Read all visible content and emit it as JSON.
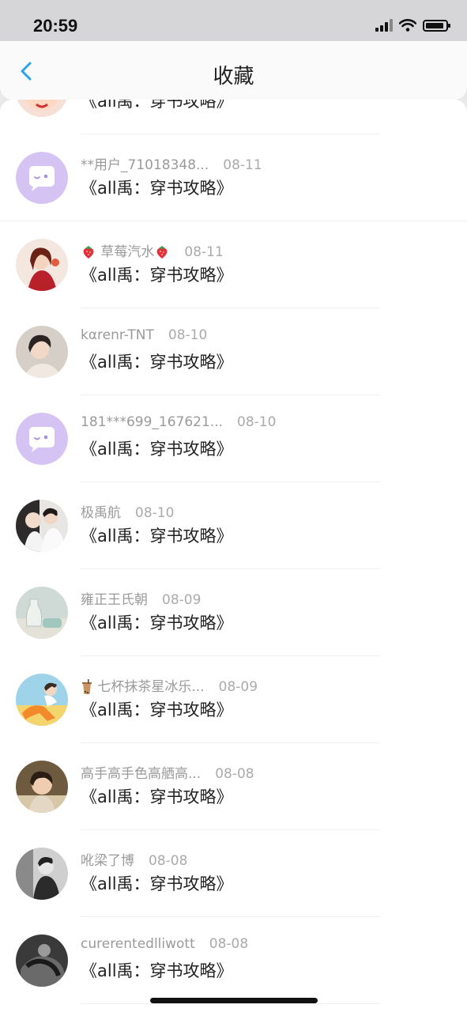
{
  "status": {
    "time": "20:59"
  },
  "nav": {
    "title": "收藏"
  },
  "book_title": "《all禹：穿书攻略》",
  "items": [
    {
      "user": "",
      "date": "",
      "book": "《all禹：穿书攻略》",
      "avatar": "tnt-cartoon"
    },
    {
      "user": "**用户_71018348...",
      "date": "08-11",
      "book": "《all禹：穿书攻略》",
      "avatar": "default-chat"
    },
    {
      "user": "草莓汽水",
      "date": "08-11",
      "book": "《all禹：穿书攻略》",
      "avatar": "girl-red-dress",
      "emoji": "strawberry"
    },
    {
      "user": "kαrenr-TNT",
      "date": "08-10",
      "book": "《all禹：穿书攻略》",
      "avatar": "boy-portrait"
    },
    {
      "user": "181***699_167621...",
      "date": "08-10",
      "book": "《all禹：穿书攻略》",
      "avatar": "default-chat"
    },
    {
      "user": "极禹航",
      "date": "08-10",
      "book": "《all禹：穿书攻略》",
      "avatar": "couple-photo"
    },
    {
      "user": "雍正王氏朝",
      "date": "08-09",
      "book": "《all禹：穿书攻略》",
      "avatar": "still-life"
    },
    {
      "user": "七杯抹茶星冰乐...",
      "date": "08-09",
      "book": "《all禹：穿书攻略》",
      "avatar": "boy-yellow",
      "emoji": "bubble-tea"
    },
    {
      "user": "高手高手色高舾高...",
      "date": "08-08",
      "book": "《all禹：穿书攻略》",
      "avatar": "child-photo"
    },
    {
      "user": "吪梁了博",
      "date": "08-08",
      "book": "《all禹：穿书攻略》",
      "avatar": "man-bw"
    },
    {
      "user": "curerentedlliwott",
      "date": "08-08",
      "book": "《all禹：穿书攻略》",
      "avatar": "dark-bw"
    }
  ]
}
